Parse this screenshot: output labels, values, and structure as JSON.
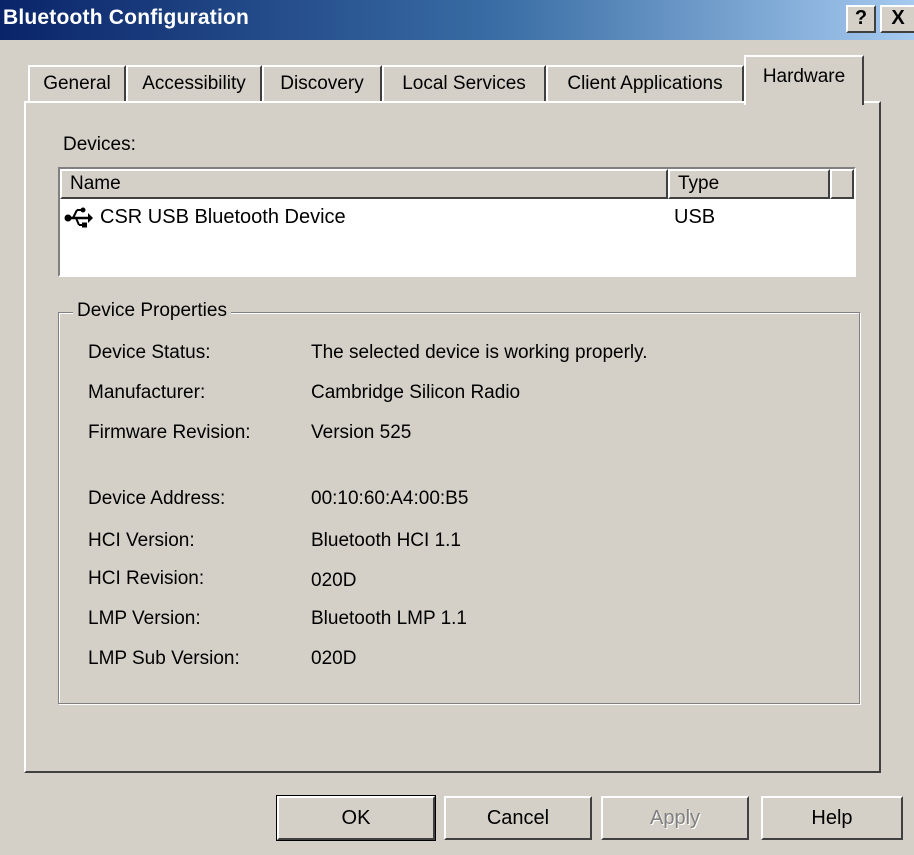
{
  "window": {
    "title": "Bluetooth Configuration",
    "help_label": "?",
    "close_label": "X"
  },
  "tabs": [
    {
      "label": "General"
    },
    {
      "label": "Accessibility"
    },
    {
      "label": "Discovery"
    },
    {
      "label": "Local Services"
    },
    {
      "label": "Client Applications"
    },
    {
      "label": "Hardware",
      "active": true
    }
  ],
  "devices": {
    "label": "Devices:",
    "columns": {
      "name": "Name",
      "type": "Type"
    },
    "rows": [
      {
        "icon": "usb-icon",
        "name": "CSR USB Bluetooth Device",
        "type": "USB"
      }
    ]
  },
  "properties": {
    "legend": "Device Properties",
    "items": [
      {
        "label": "Device Status:",
        "value": "The selected device is working properly."
      },
      {
        "label": "Manufacturer:",
        "value": "Cambridge Silicon Radio"
      },
      {
        "label": "Firmware Revision:",
        "value": "Version 525"
      },
      {
        "label": "Device Address:",
        "value": "00:10:60:A4:00:B5"
      },
      {
        "label": "HCI Version:",
        "value": "Bluetooth HCI 1.1"
      },
      {
        "label": "HCI Revision:",
        "value": "020D"
      },
      {
        "label": "LMP Version:",
        "value": "Bluetooth LMP 1.1"
      },
      {
        "label": "LMP Sub Version:",
        "value": "020D"
      }
    ]
  },
  "buttons": {
    "ok": "OK",
    "cancel": "Cancel",
    "apply": "Apply",
    "help": "Help"
  }
}
